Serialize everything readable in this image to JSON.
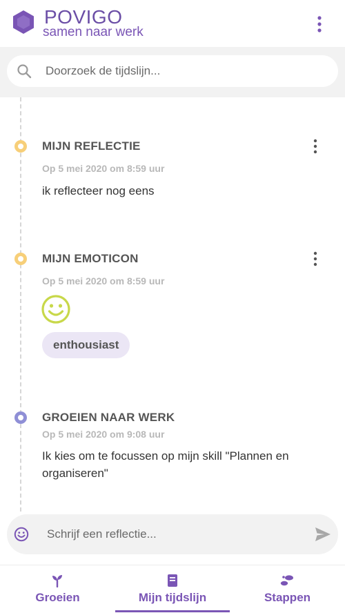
{
  "header": {
    "brand_title": "POVIGO",
    "brand_subtitle": "samen naar werk",
    "logo_icon": "hexagon-logo-icon",
    "menu_icon": "more-vertical-icon"
  },
  "search": {
    "placeholder": "Doorzoek de tijdslijn...",
    "value": "",
    "icon": "search-icon"
  },
  "timeline": {
    "entries": [
      {
        "title": "MIJN REFLECTIE",
        "date": "Op 5 mei 2020 om 8:59 uur",
        "text": "ik reflecteer nog eens",
        "dot_color": "#f7cf79",
        "has_menu": true
      },
      {
        "title": "MIJN EMOTICON",
        "date": "Op 5 mei 2020 om 8:59 uur",
        "emoticon": "smiley-icon",
        "emoticon_color": "#c8d84a",
        "tag": "enthousiast",
        "dot_color": "#f7cf79",
        "has_menu": true
      },
      {
        "title": "GROEIEN NAAR WERK",
        "date": "Op 5 mei 2020 om 9:08 uur",
        "text_line1": "Ik kies om te focussen op mijn skill \"Plannen en",
        "text_line2": "organiseren\"",
        "dot_color": "#8f8fd6",
        "has_menu": false
      }
    ]
  },
  "compose": {
    "placeholder": "Schrijf een reflectie...",
    "value": "",
    "emoji_icon": "smiley-outline-icon",
    "send_icon": "send-icon"
  },
  "bottom_nav": {
    "items": [
      {
        "label": "Groeien",
        "icon": "sprout-icon"
      },
      {
        "label": "Mijn tijdslijn",
        "icon": "book-icon",
        "active": true
      },
      {
        "label": "Stappen",
        "icon": "footsteps-icon"
      }
    ]
  },
  "colors": {
    "brand": "#7a55b5",
    "accent_yellow": "#f7cf79",
    "accent_purple": "#8f8fd6",
    "tag_bg": "#ebe6f5"
  }
}
